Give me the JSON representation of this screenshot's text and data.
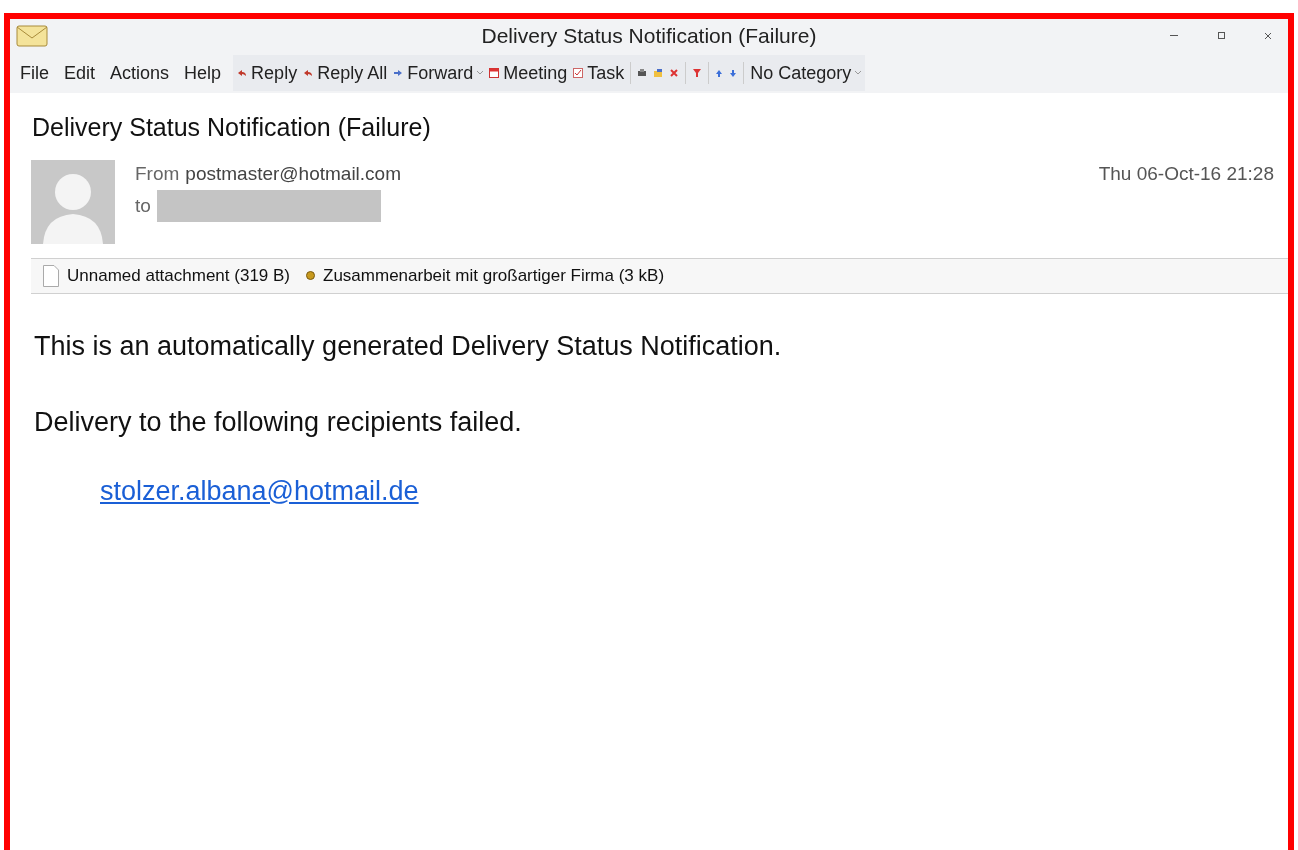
{
  "window": {
    "title": "Delivery Status Notification (Failure)"
  },
  "menu": [
    "File",
    "Edit",
    "Actions",
    "Help"
  ],
  "toolbar": [
    {
      "kind": "reply",
      "label": "Reply"
    },
    {
      "kind": "reply",
      "label": "Reply All"
    },
    {
      "kind": "forward",
      "label": "Forward",
      "dropdown": true
    },
    {
      "kind": "meeting",
      "label": "Meeting"
    },
    {
      "kind": "task",
      "label": "Task"
    }
  ],
  "category": {
    "label": "No Category"
  },
  "message": {
    "subject": "Delivery Status Notification (Failure)",
    "from_label": "From",
    "from": "postmaster@hotmail.com",
    "to_label": "to",
    "date": "Thu 06-Oct-16 21:28"
  },
  "attachments": [
    {
      "kind": "file",
      "name": "Unnamed attachment (319 B)"
    },
    {
      "kind": "dot",
      "name": "Zusammenarbeit mit großartiger Firma (3 kB)"
    }
  ],
  "body": {
    "paragraphs": [
      "This is an automatically generated Delivery Status Notification.",
      "Delivery to the following recipients failed."
    ],
    "recipient": "stolzer.albana@hotmail.de"
  }
}
